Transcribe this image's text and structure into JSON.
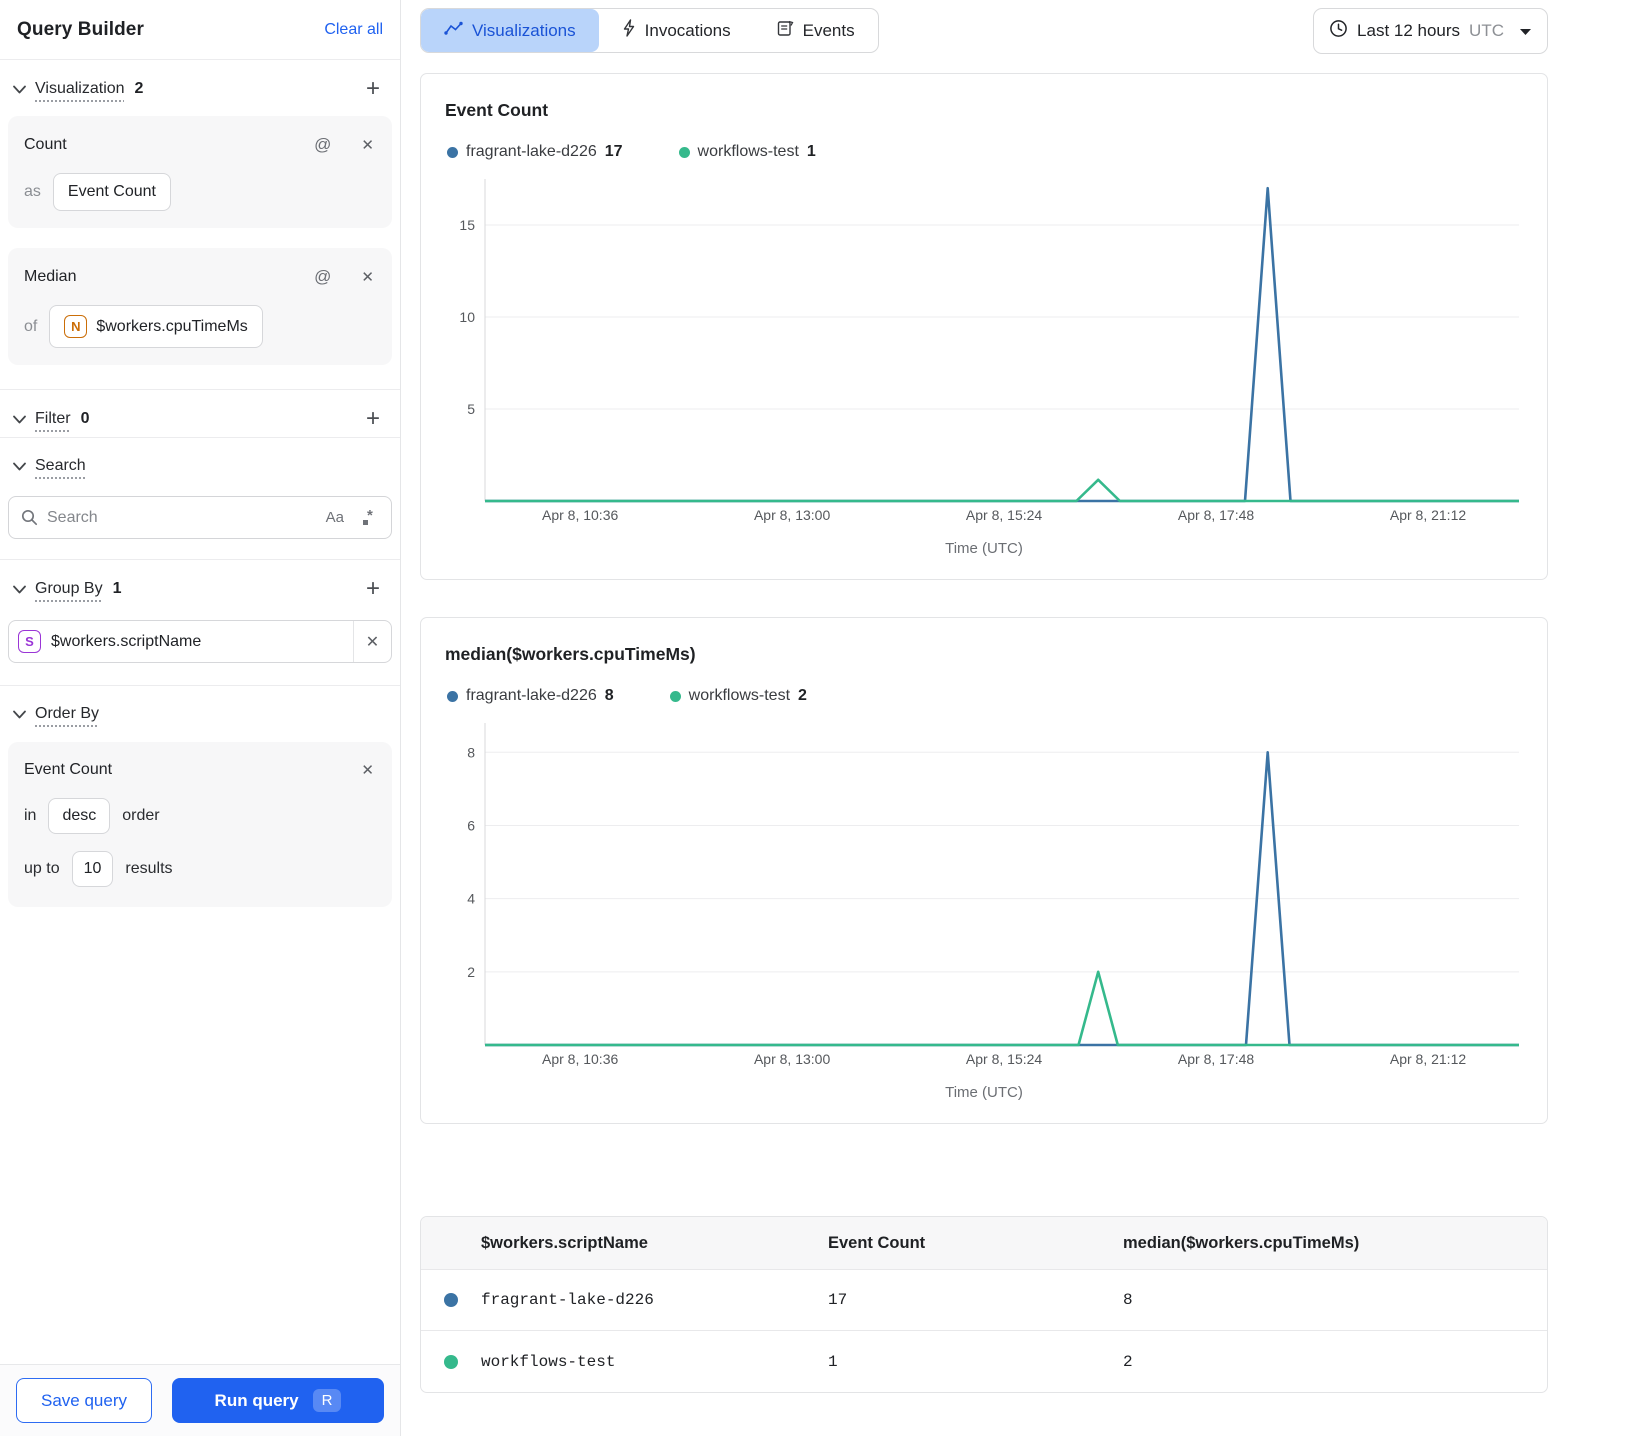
{
  "sidebar": {
    "title": "Query Builder",
    "clear_all": "Clear all",
    "visualization": {
      "label": "Visualization",
      "count": "2",
      "cards": [
        {
          "title": "Count",
          "prefix": "as",
          "value": "Event Count"
        },
        {
          "title": "Median",
          "prefix": "of",
          "badge": "N",
          "value": "$workers.cpuTimeMs"
        }
      ]
    },
    "filter": {
      "label": "Filter",
      "count": "0"
    },
    "search": {
      "label": "Search",
      "placeholder": "Search",
      "match_case": "Aa"
    },
    "group_by": {
      "label": "Group By",
      "count": "1",
      "items": [
        {
          "badge": "S",
          "value": "$workers.scriptName"
        }
      ]
    },
    "order_by": {
      "label": "Order By",
      "field": "Event Count",
      "in_label": "in",
      "direction": "desc",
      "order_label": "order",
      "up_to_label": "up to",
      "limit": "10",
      "results_label": "results"
    },
    "footer": {
      "save": "Save query",
      "run": "Run query",
      "shortcut": "R"
    }
  },
  "header": {
    "tabs": [
      {
        "label": "Visualizations",
        "active": true
      },
      {
        "label": "Invocations",
        "active": false
      },
      {
        "label": "Events",
        "active": false
      }
    ],
    "time_range": {
      "label": "Last 12 hours",
      "timezone": "UTC"
    }
  },
  "chart_data": [
    {
      "type": "line",
      "title": "Event Count",
      "xlabel": "Time (UTC)",
      "x_ticks": [
        "Apr 8, 10:36",
        "Apr 8, 13:00",
        "Apr 8, 15:24",
        "Apr 8, 17:48",
        "Apr 8, 21:12"
      ],
      "tick_fracs": [
        0.092,
        0.297,
        0.502,
        0.707,
        0.912
      ],
      "y_ticks": [
        5,
        10,
        15
      ],
      "ylim": [
        0,
        17.5
      ],
      "grid": true,
      "legend_position": "top",
      "series": [
        {
          "name": "fragrant-lake-d226",
          "total": 17,
          "color": "#3b73a4",
          "points": [
            [
              0,
              0
            ],
            [
              0.735,
              0
            ],
            [
              0.757,
              17
            ],
            [
              0.779,
              0
            ],
            [
              1,
              0
            ]
          ]
        },
        {
          "name": "workflows-test",
          "total": 1,
          "color": "#35b98c",
          "points": [
            [
              0,
              0
            ],
            [
              0.572,
              0
            ],
            [
              0.593,
              1.15
            ],
            [
              0.614,
              0
            ],
            [
              1,
              0
            ]
          ]
        }
      ]
    },
    {
      "type": "line",
      "title": "median($workers.cpuTimeMs)",
      "xlabel": "Time (UTC)",
      "x_ticks": [
        "Apr 8, 10:36",
        "Apr 8, 13:00",
        "Apr 8, 15:24",
        "Apr 8, 17:48",
        "Apr 8, 21:12"
      ],
      "tick_fracs": [
        0.092,
        0.297,
        0.502,
        0.707,
        0.912
      ],
      "y_ticks": [
        2,
        4,
        6,
        8
      ],
      "ylim": [
        0,
        8.8
      ],
      "grid": true,
      "legend_position": "top",
      "series": [
        {
          "name": "fragrant-lake-d226",
          "total": 8,
          "color": "#3b73a4",
          "points": [
            [
              0,
              0
            ],
            [
              0.736,
              0
            ],
            [
              0.757,
              8
            ],
            [
              0.778,
              0
            ],
            [
              1,
              0
            ]
          ]
        },
        {
          "name": "workflows-test",
          "total": 2,
          "color": "#35b98c",
          "points": [
            [
              0,
              0
            ],
            [
              0.574,
              0
            ],
            [
              0.593,
              2
            ],
            [
              0.612,
              0
            ],
            [
              1,
              0
            ]
          ]
        }
      ]
    }
  ],
  "table": {
    "headers": [
      "$workers.scriptName",
      "Event Count",
      "median($workers.cpuTimeMs)"
    ],
    "rows": [
      {
        "color": "#3b73a4",
        "name": "fragrant-lake-d226",
        "event_count": "17",
        "median": "8"
      },
      {
        "color": "#35b98c",
        "name": "workflows-test",
        "event_count": "1",
        "median": "2"
      }
    ]
  },
  "colors": {
    "accent_blue": "#2062f0",
    "series_blue": "#3b73a4",
    "series_green": "#35b98c",
    "tab_selected_bg": "#b9d4fa",
    "axis_text": "#55585c",
    "gridline": "#ededef"
  }
}
